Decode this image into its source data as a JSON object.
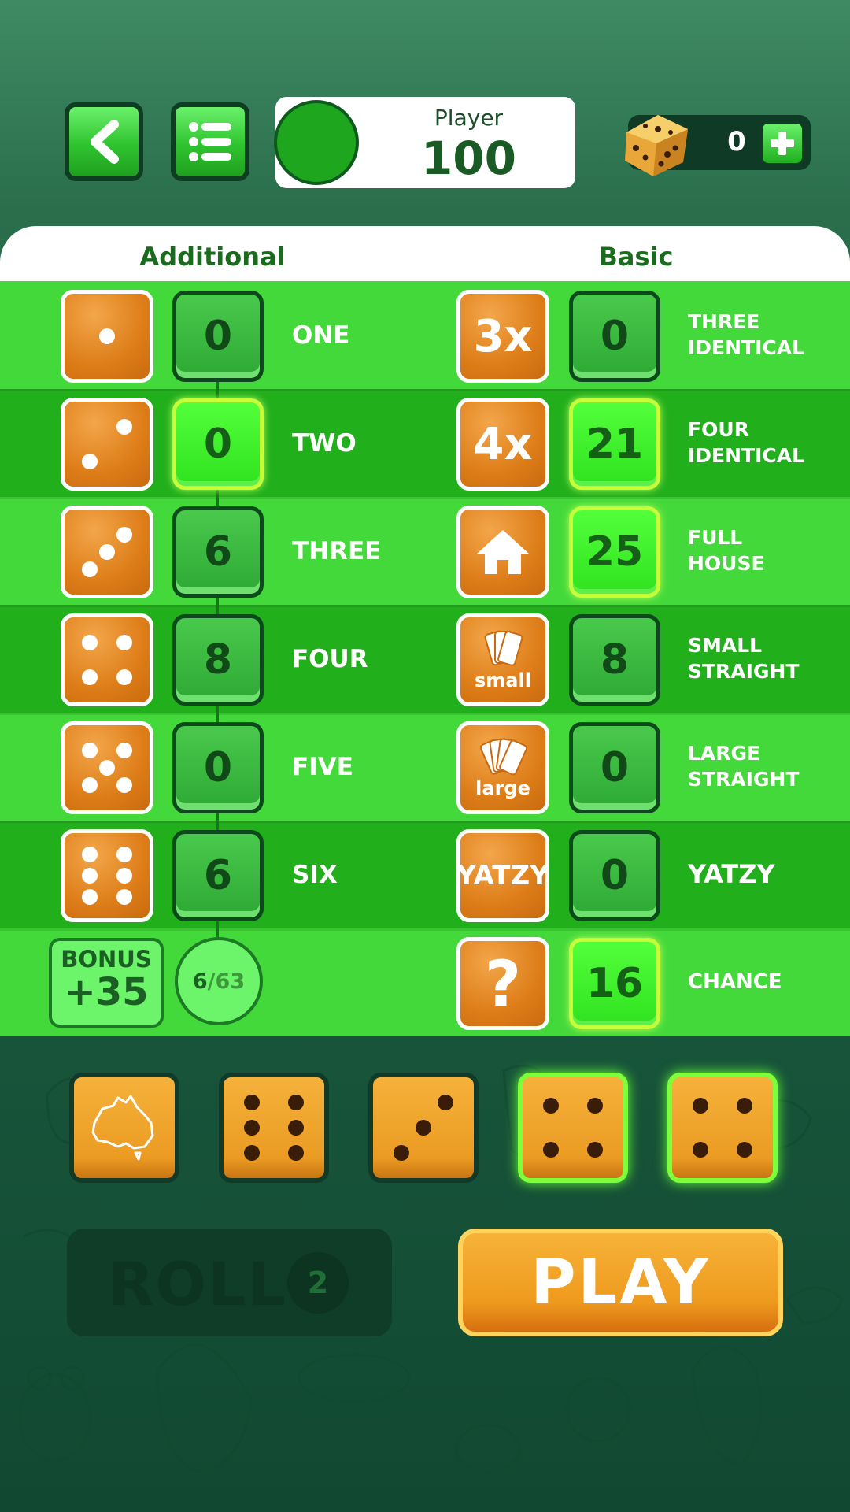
{
  "header": {
    "player_label": "Player",
    "player_score": "100",
    "coins": "0"
  },
  "sheet": {
    "left_title": "Additional",
    "right_title": "Basic",
    "left_rows": [
      {
        "label": "ONE",
        "score": "0",
        "pips": 1,
        "highlight": false
      },
      {
        "label": "TWO",
        "score": "0",
        "pips": 2,
        "highlight": true
      },
      {
        "label": "THREE",
        "score": "6",
        "pips": 3,
        "highlight": false
      },
      {
        "label": "FOUR",
        "score": "8",
        "pips": 4,
        "highlight": false
      },
      {
        "label": "FIVE",
        "score": "0",
        "pips": 5,
        "highlight": false
      },
      {
        "label": "SIX",
        "score": "6",
        "pips": 6,
        "highlight": false
      }
    ],
    "right_rows": [
      {
        "icon_text": "3x",
        "label1": "THREE",
        "label2": "IDENTICAL",
        "score": "0",
        "highlight": false
      },
      {
        "icon_text": "4x",
        "label1": "FOUR",
        "label2": "IDENTICAL",
        "score": "21",
        "highlight": true
      },
      {
        "icon": "house-icon",
        "label1": "FULL",
        "label2": "HOUSE",
        "score": "25",
        "highlight": true
      },
      {
        "icon": "cards-icon",
        "icon_text": "small",
        "label1": "SMALL",
        "label2": "STRAIGHT",
        "score": "8",
        "highlight": false
      },
      {
        "icon": "cards-icon",
        "icon_text": "large",
        "label1": "LARGE",
        "label2": "STRAIGHT",
        "score": "0",
        "highlight": false
      },
      {
        "icon_text": "YATZY",
        "label1": "YATZY",
        "score": "0",
        "highlight": false
      },
      {
        "icon_text": "?",
        "label1": "CHANCE",
        "score": "16",
        "highlight": true
      }
    ],
    "bonus": {
      "label": "BONUS",
      "value": "+35",
      "progress": "6",
      "target": "/63"
    }
  },
  "dice": [
    {
      "face": "australia-map-icon",
      "held": false
    },
    {
      "face": 6,
      "held": false
    },
    {
      "face": 3,
      "held": false
    },
    {
      "face": 4,
      "held": true
    },
    {
      "face": 4,
      "held": true
    }
  ],
  "controls": {
    "roll_label": "ROLL",
    "rolls_left": "2",
    "play_label": "PLAY"
  },
  "colors": {
    "accent_green": "#44d93a",
    "dark_green_row": "#22af1c",
    "orange": "#dd7d18"
  }
}
